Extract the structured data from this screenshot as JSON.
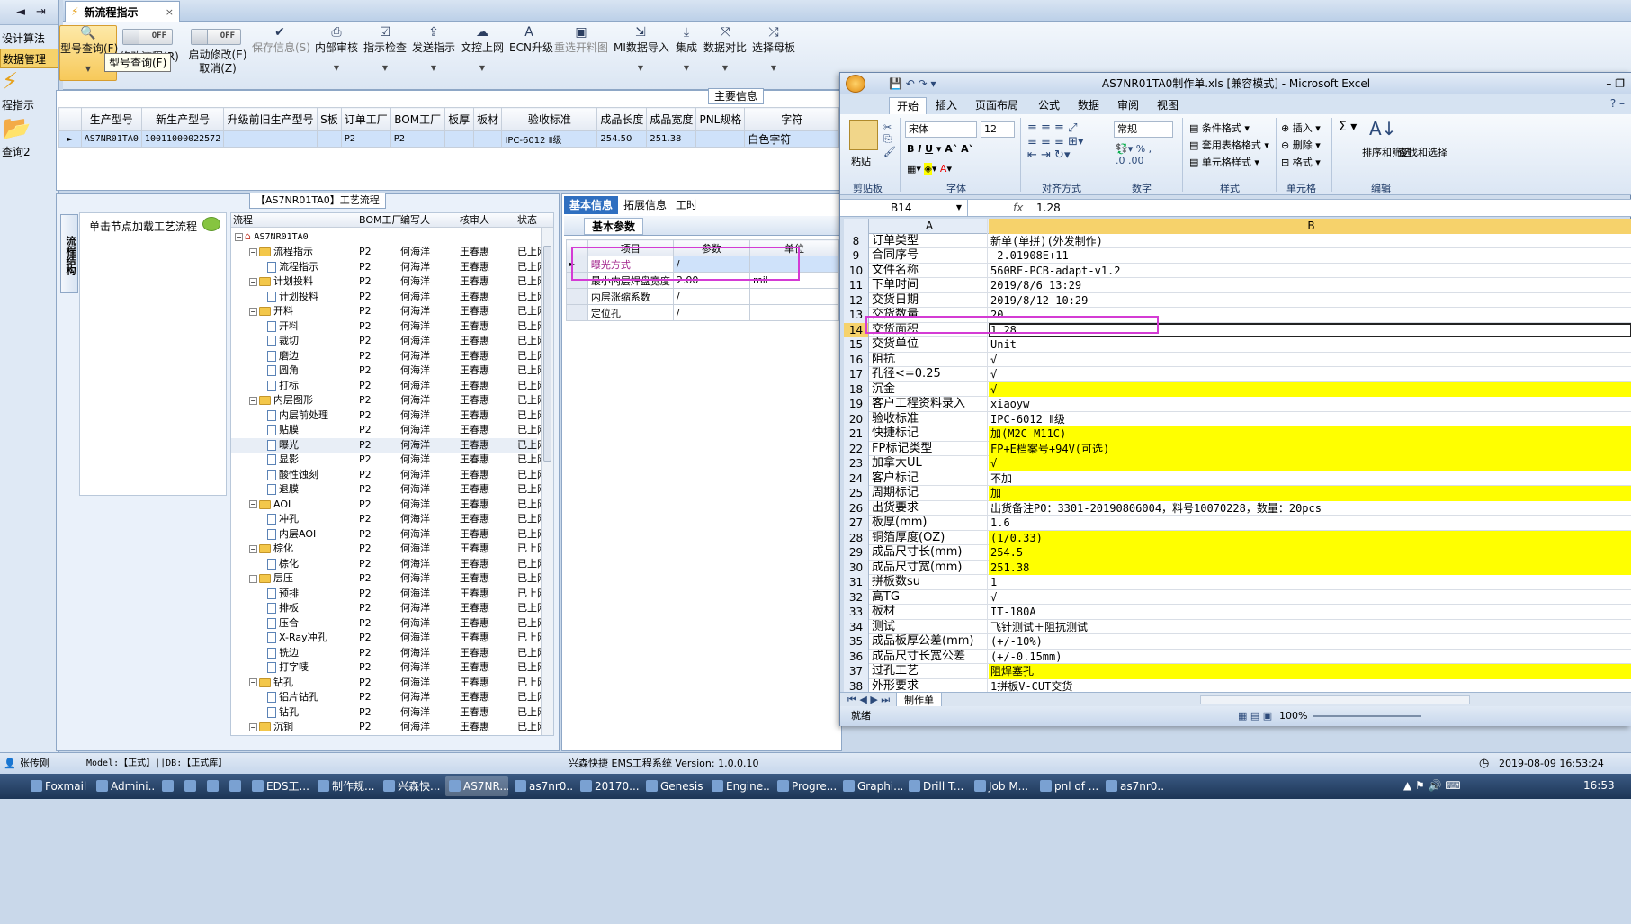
{
  "left_nav": {
    "items": [
      {
        "label": "设计算法",
        "active": false
      },
      {
        "label": "数据管理",
        "active": true
      },
      {
        "label": "程指示",
        "active": false
      },
      {
        "label": "查询2",
        "active": false
      }
    ]
  },
  "doc_tab": {
    "title": "新流程指示",
    "close": "×"
  },
  "toolbar": {
    "buttons": [
      {
        "label": "型号查询(F)",
        "icon": "search-icon"
      },
      {
        "label": "修改流程(R)",
        "icon": "toggle-icon"
      },
      {
        "label": "启动修改(E)",
        "sub": "取消(Z)",
        "icon": "toggle-icon"
      },
      {
        "label": "保存信息(S)",
        "icon": "check-icon",
        "disabled": true
      },
      {
        "label": "内部审核",
        "icon": "printer-icon"
      },
      {
        "label": "指示检查",
        "icon": "checklist-icon"
      },
      {
        "label": "发送指示",
        "icon": "upload-icon"
      },
      {
        "label": "文控上网",
        "icon": "cloud-upload-icon"
      },
      {
        "label": "ECN升级",
        "icon": "ecn-icon"
      },
      {
        "label": "重选开料图",
        "icon": "image-icon",
        "disabled": true
      },
      {
        "label": "MI数据导入",
        "icon": "import-icon"
      },
      {
        "label": "集成",
        "icon": "download-icon"
      },
      {
        "label": "数据对比",
        "icon": "compare-icon"
      },
      {
        "label": "选择母板",
        "icon": "shuffle-icon"
      }
    ],
    "toggle_off_label": "OFF",
    "tooltip": "型号查询(F)"
  },
  "main_info": {
    "group_title": "主要信息",
    "columns": [
      "生产型号",
      "新生产型号",
      "升级前旧生产型号",
      "S板",
      "订单工厂",
      "BOM工厂",
      "板厚",
      "板材",
      "验收标准",
      "成品长度",
      "成品宽度",
      "PNL规格",
      "字符"
    ],
    "row": [
      "AS7NR01TA0",
      "10011000022572",
      "",
      "",
      "P2",
      "P2",
      "",
      "",
      "IPC-6012 Ⅱ级",
      "254.50",
      "251.38",
      "",
      "白色字符"
    ]
  },
  "process": {
    "group_title": "【AS7NR01TA0】工艺流程",
    "side_tab": "流程结构",
    "load_hint": "单击节点加载工艺流程",
    "columns": [
      "流程",
      "BOM工厂",
      "编写人",
      "核审人",
      "状态"
    ],
    "root": "AS7NR01TA0",
    "rows": [
      {
        "name": "流程指示",
        "level": 1,
        "type": "folder"
      },
      {
        "name": "流程指示",
        "level": 2,
        "type": "file"
      },
      {
        "name": "计划投料",
        "level": 1,
        "type": "folder"
      },
      {
        "name": "计划投料",
        "level": 2,
        "type": "file"
      },
      {
        "name": "开料",
        "level": 1,
        "type": "folder"
      },
      {
        "name": "开料",
        "level": 2,
        "type": "file"
      },
      {
        "name": "裁切",
        "level": 2,
        "type": "file"
      },
      {
        "name": "磨边",
        "level": 2,
        "type": "file"
      },
      {
        "name": "圆角",
        "level": 2,
        "type": "file"
      },
      {
        "name": "打标",
        "level": 2,
        "type": "file"
      },
      {
        "name": "内层图形",
        "level": 1,
        "type": "folder"
      },
      {
        "name": "内层前处理",
        "level": 2,
        "type": "file"
      },
      {
        "name": "贴膜",
        "level": 2,
        "type": "file"
      },
      {
        "name": "曝光",
        "level": 2,
        "type": "file",
        "highlight": true
      },
      {
        "name": "显影",
        "level": 2,
        "type": "file"
      },
      {
        "name": "酸性蚀刻",
        "level": 2,
        "type": "file"
      },
      {
        "name": "退膜",
        "level": 2,
        "type": "file"
      },
      {
        "name": "AOI",
        "level": 1,
        "type": "folder"
      },
      {
        "name": "冲孔",
        "level": 2,
        "type": "file"
      },
      {
        "name": "内层AOI",
        "level": 2,
        "type": "file"
      },
      {
        "name": "棕化",
        "level": 1,
        "type": "folder"
      },
      {
        "name": "棕化",
        "level": 2,
        "type": "file"
      },
      {
        "name": "层压",
        "level": 1,
        "type": "folder"
      },
      {
        "name": "预排",
        "level": 2,
        "type": "file"
      },
      {
        "name": "排板",
        "level": 2,
        "type": "file"
      },
      {
        "name": "压合",
        "level": 2,
        "type": "file"
      },
      {
        "name": "X-Ray冲孔",
        "level": 2,
        "type": "file"
      },
      {
        "name": "铣边",
        "level": 2,
        "type": "file"
      },
      {
        "name": "打字唛",
        "level": 2,
        "type": "file"
      },
      {
        "name": "钻孔",
        "level": 1,
        "type": "folder"
      },
      {
        "name": "铝片钻孔",
        "level": 2,
        "type": "file"
      },
      {
        "name": "钻孔",
        "level": 2,
        "type": "file"
      },
      {
        "name": "沉铜",
        "level": 1,
        "type": "folder"
      }
    ],
    "bom": "P2",
    "writer": "何海洋",
    "reviewer": "王春惠",
    "status": "已上网"
  },
  "info_panel": {
    "tabs": [
      "基本信息",
      "拓展信息",
      "工时"
    ],
    "subtab": "基本参数",
    "columns": [
      "项目",
      "参数",
      "单位"
    ],
    "rows": [
      {
        "item": "曝光方式",
        "param": "/",
        "unit": ""
      },
      {
        "item": "最小内层焊盘宽度",
        "param": "2.00",
        "unit": "mil"
      },
      {
        "item": "内层涨缩系数",
        "param": "/",
        "unit": ""
      },
      {
        "item": "定位孔",
        "param": "/",
        "unit": ""
      }
    ]
  },
  "excel": {
    "title": "AS7NR01TA0制作单.xls [兼容模式] - Microsoft Excel",
    "tabs": [
      "开始",
      "插入",
      "页面布局",
      "公式",
      "数据",
      "审阅",
      "视图"
    ],
    "groups": [
      "剪贴板",
      "字体",
      "对齐方式",
      "数字",
      "样式",
      "单元格",
      "编辑"
    ],
    "font_name": "宋体",
    "font_size": "12",
    "number_format": "常规",
    "paste_label": "粘贴",
    "style_items": [
      "条件格式",
      "套用表格格式",
      "单元格样式"
    ],
    "cell_items": [
      "插入",
      "删除",
      "格式"
    ],
    "edit_items": [
      "排序和筛选",
      "查找和选择"
    ],
    "name_box": "B14",
    "formula": "1.28",
    "col_headers": [
      "A",
      "B"
    ],
    "rows": [
      {
        "n": "8",
        "a": "订单类型",
        "b": "新单(单拼)(外发制作)",
        "y": false
      },
      {
        "n": "9",
        "a": "合同序号",
        "b": "-2.01908E+11",
        "y": false
      },
      {
        "n": "10",
        "a": "文件名称",
        "b": "560RF-PCB-adapt-v1.2",
        "y": false
      },
      {
        "n": "11",
        "a": "下单时间",
        "b": "2019/8/6 13:29",
        "y": false
      },
      {
        "n": "12",
        "a": "交货日期",
        "b": "2019/8/12 10:29",
        "y": false
      },
      {
        "n": "13",
        "a": "交货数量",
        "b": "20",
        "y": false
      },
      {
        "n": "14",
        "a": "交货面积",
        "b": "1.28",
        "y": false
      },
      {
        "n": "15",
        "a": "交货单位",
        "b": "Unit",
        "y": false
      },
      {
        "n": "16",
        "a": "阻抗",
        "b": "√",
        "y": false
      },
      {
        "n": "17",
        "a": "孔径<=0.25",
        "b": "√",
        "y": false
      },
      {
        "n": "18",
        "a": "沉金",
        "b": "√",
        "y": true
      },
      {
        "n": "19",
        "a": "客户工程资料录入",
        "b": "xiaoyw",
        "y": false
      },
      {
        "n": "20",
        "a": "验收标准",
        "b": "IPC-6012 Ⅱ级",
        "y": false
      },
      {
        "n": "21",
        "a": "快捷标记",
        "b": "加(M2C M11C)",
        "y": true
      },
      {
        "n": "22",
        "a": "FP标记类型",
        "b": "FP+E档案号+94V(可选)",
        "y": true
      },
      {
        "n": "23",
        "a": "加拿大UL",
        "b": "√",
        "y": true
      },
      {
        "n": "24",
        "a": "客户标记",
        "b": "不加",
        "y": false
      },
      {
        "n": "25",
        "a": "周期标记",
        "b": "加",
        "y": true
      },
      {
        "n": "26",
        "a": "出货要求",
        "b": "出货备注PO：3301-20190806004，料号10070228，数量：20pcs",
        "y": false
      },
      {
        "n": "27",
        "a": "板厚(mm)",
        "b": "1.6",
        "y": false
      },
      {
        "n": "28",
        "a": "铜箔厚度(OZ)",
        "b": "(1/0.33)",
        "y": true
      },
      {
        "n": "29",
        "a": "成品尺寸长(mm)",
        "b": "254.5",
        "y": true
      },
      {
        "n": "30",
        "a": "成品尺寸宽(mm)",
        "b": "251.38",
        "y": true
      },
      {
        "n": "31",
        "a": "拼板数su",
        "b": "1",
        "y": false
      },
      {
        "n": "32",
        "a": "高TG",
        "b": "√",
        "y": false
      },
      {
        "n": "33",
        "a": "板材",
        "b": "IT-180A",
        "y": false
      },
      {
        "n": "34",
        "a": "测试",
        "b": "飞针测试＋阻抗测试",
        "y": false
      },
      {
        "n": "35",
        "a": "成品板厚公差(mm)",
        "b": "(+/-10%)",
        "y": false
      },
      {
        "n": "36",
        "a": "成品尺寸长宽公差",
        "b": "(+/-0.15mm)",
        "y": false
      },
      {
        "n": "37",
        "a": "过孔工艺",
        "b": "阻焊塞孔",
        "y": true
      },
      {
        "n": "38",
        "a": "外形要求",
        "b": "1拼板V-CUT交货",
        "y": false
      }
    ],
    "sheet_tab": "制作单",
    "status_left": "就绪",
    "zoom": "100%"
  },
  "app_status": {
    "user": "张传刚",
    "model": "Model:【正式】||DB:【正式库】",
    "system": "兴森快捷 EMS工程系统 Version: 1.0.0.10",
    "datetime": "2019-08-09 16:53:24"
  },
  "taskbar": {
    "items": [
      "Foxmail",
      "Admini...",
      "",
      "",
      "",
      "",
      "EDS工...",
      "制作规...",
      "兴森快...",
      "AS7NR...",
      "as7nr0...",
      "20170...",
      "Genesis",
      "Engine...",
      "Progre...",
      "Graphi...",
      "Drill T...",
      "Job M...",
      "pnl of ...",
      "as7nr0..."
    ],
    "time": "16:53"
  }
}
